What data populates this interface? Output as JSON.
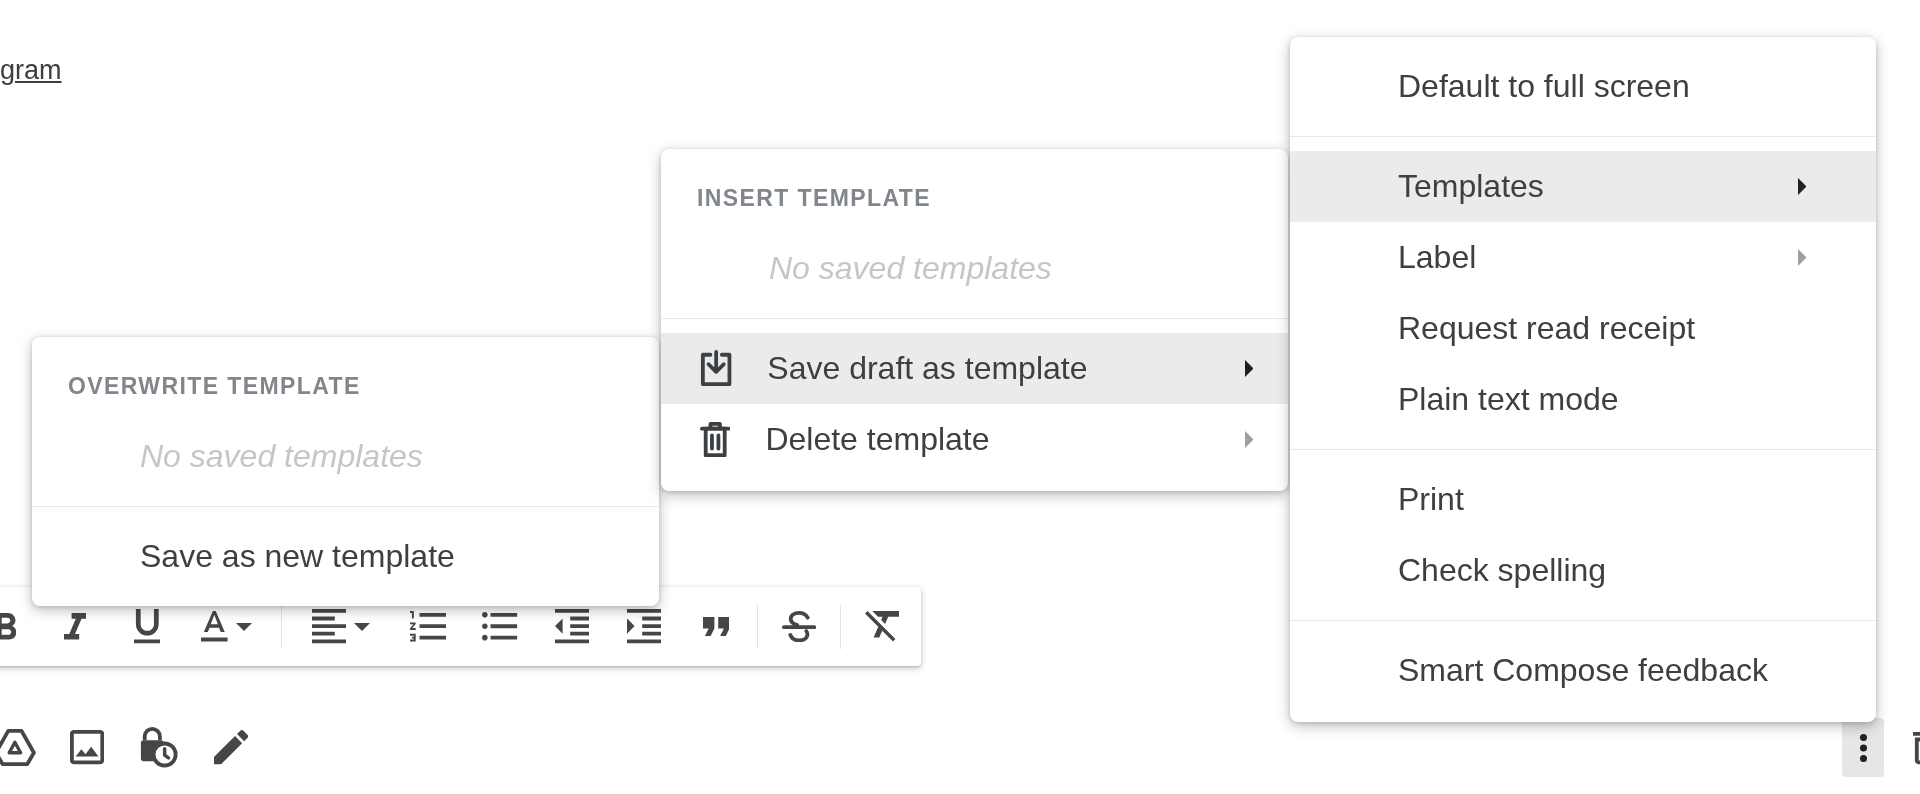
{
  "message_body": {
    "link_text": "gram"
  },
  "more_options_menu": {
    "sections": [
      {
        "items": [
          {
            "label": "Default to full screen",
            "selected": false,
            "disabled": false,
            "submenu": false
          }
        ]
      },
      {
        "items": [
          {
            "label": "Templates",
            "selected": true,
            "disabled": false,
            "submenu": true
          },
          {
            "label": "Label",
            "selected": false,
            "disabled": false,
            "submenu": true
          },
          {
            "label": "Request read receipt",
            "selected": false,
            "disabled": false,
            "submenu": false
          },
          {
            "label": "Plain text mode",
            "selected": false,
            "disabled": false,
            "submenu": false
          }
        ]
      },
      {
        "items": [
          {
            "label": "Print",
            "selected": false,
            "disabled": false,
            "submenu": false
          },
          {
            "label": "Check spelling",
            "selected": false,
            "disabled": false,
            "submenu": false
          }
        ]
      },
      {
        "items": [
          {
            "label": "Smart Compose feedback",
            "selected": false,
            "disabled": false,
            "submenu": false
          }
        ]
      }
    ]
  },
  "templates_menu": {
    "sections": [
      {
        "heading": "INSERT TEMPLATE",
        "items": [
          {
            "label": "No saved templates",
            "selected": false,
            "disabled": true,
            "submenu": false
          }
        ]
      },
      {
        "items": [
          {
            "label": "Save draft as template",
            "selected": true,
            "disabled": false,
            "submenu": true
          },
          {
            "label": "Delete template",
            "selected": false,
            "disabled": false,
            "submenu": true
          }
        ]
      }
    ]
  },
  "save_draft_menu": {
    "sections": [
      {
        "heading": "OVERWRITE TEMPLATE",
        "items": [
          {
            "label": "No saved templates",
            "selected": false,
            "disabled": true,
            "submenu": false
          }
        ]
      },
      {
        "items": [
          {
            "label": "Save as new template",
            "selected": false,
            "disabled": false,
            "submenu": false
          }
        ]
      }
    ]
  },
  "compose_actions": {
    "more_button": {
      "active": true
    }
  }
}
